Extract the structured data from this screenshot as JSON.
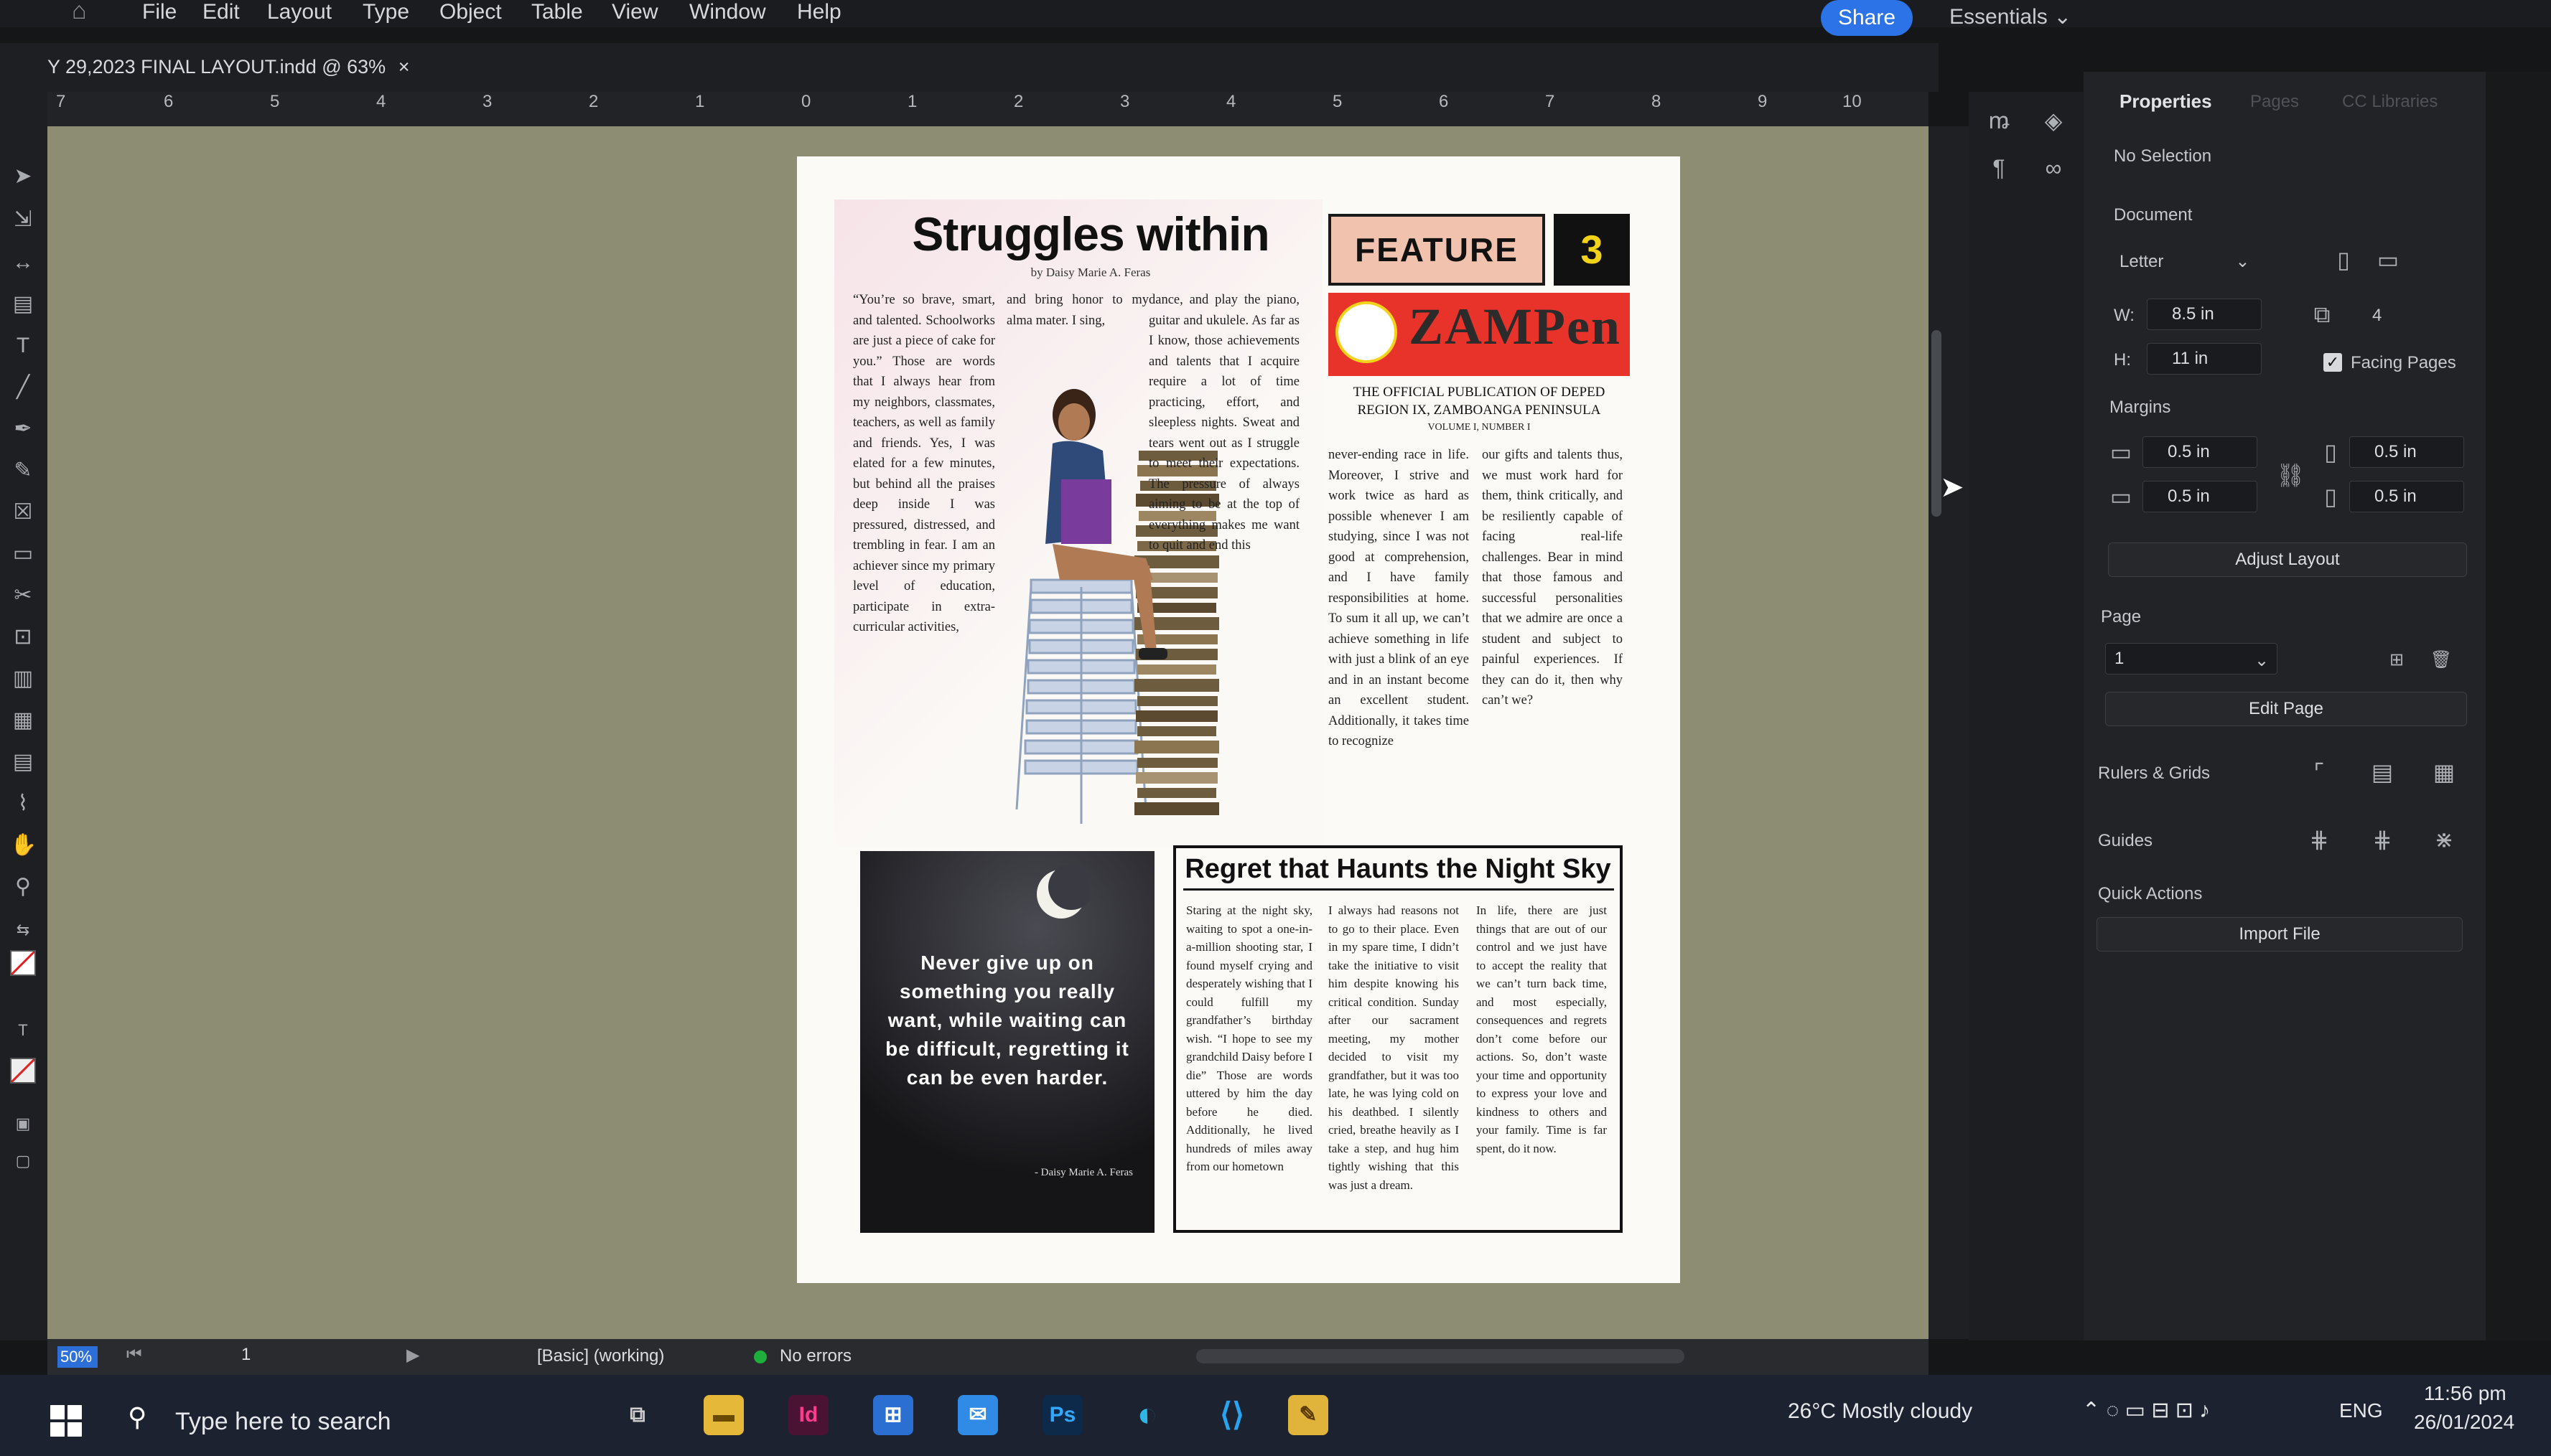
{
  "menubar": {
    "items": [
      "File",
      "Edit",
      "Layout",
      "Type",
      "Object",
      "Table",
      "View",
      "Window",
      "Help"
    ],
    "share": "Share",
    "workspace": "Essentials"
  },
  "tab": {
    "title": "Y 29,2023 FINAL LAYOUT.indd @ 63%",
    "close": "×"
  },
  "ruler": {
    "ticks": [
      "7",
      "6",
      "5",
      "4",
      "3",
      "2",
      "1",
      "0",
      "1",
      "2",
      "3",
      "4",
      "5",
      "6",
      "7",
      "8",
      "9",
      "10"
    ]
  },
  "properties": {
    "tabs": [
      "Properties",
      "Pages",
      "CC Libraries"
    ],
    "selection": "No Selection",
    "document_title": "Document",
    "preset": "Letter",
    "width_label": "W:",
    "width": "8.5 in",
    "height_label": "H:",
    "height": "11 in",
    "pages_count": "4",
    "facing_pages": "Facing Pages",
    "margins_title": "Margins",
    "margin_top": "0.5 in",
    "margin_bottom": "0.5 in",
    "margin_left": "0.5 in",
    "margin_right": "0.5 in",
    "adjust_layout": "Adjust Layout",
    "page_title": "Page",
    "page_value": "1",
    "edit_page": "Edit Page",
    "rulers_grids": "Rulers & Grids",
    "guides": "Guides",
    "quick_actions": "Quick Actions",
    "import_file": "Import File"
  },
  "status": {
    "zoom": "50%",
    "page": "1",
    "style": "[Basic] (working)",
    "errors": "No errors"
  },
  "taskbar": {
    "search": "Type here to search",
    "weather": "26°C  Mostly cloudy",
    "lang": "ENG",
    "time": "11:56 pm",
    "date": "26/01/2024"
  },
  "article": {
    "title": "Struggles within",
    "byline": "by Daisy Marie A. Feras",
    "col1": "“You’re so brave, smart, and talented. Schoolworks are just a piece of cake for you.” Those are words that I always hear from my neighbors, classmates, teachers, as well as family and friends. Yes, I was elated for a few minutes, but behind all the praises deep inside I was pressured, distressed, and trembling in fear. I am an achiever since my primary level of education, participate in extra-curricular activities,",
    "col2a": "and bring honor to my alma mater. I sing,",
    "col3": "dance, and play the piano, guitar and ukulele. As far as I know, those achievements and talents that I acquire require a lot of time practicing, effort, and sleepless nights. Sweat and tears went out as I struggle to meet their expectations. The pressure of always aiming to be at the top of everything makes me want to quit and end this",
    "col4": "never-ending race in life. Moreover, I strive and work twice as hard as possible whenever I am studying, since I was not good at comprehension, and I have family responsibilities at home. To sum it all up, we can’t achieve something in life with just a blink of an eye and in an instant become an excellent student. Additionally, it takes time to recognize",
    "col5": "our gifts and talents thus, we must work hard for them, think critically, and be resiliently capable of facing real-life challenges. Bear in mind that those famous and successful personalities that we admire are once a student and subject to painful experiences. If they can do it, then why can’t we?"
  },
  "masthead": {
    "feature": "FEATURE",
    "number": "3",
    "logo": "ZAMPen",
    "publication": "THE OFFICIAL PUBLICATION OF DEPED REGION IX, ZAMBOANGA PENINSULA",
    "volume": "VOLUME I, NUMBER I"
  },
  "quote": {
    "text": "Never give up on something you really want, while waiting can be difficult, regretting it can be even harder.",
    "author": "- Daisy Marie A. Feras"
  },
  "regret": {
    "title": "Regret that Haunts the Night Sky",
    "col1": "Staring at the night sky, waiting to spot a one-in-a-million shooting star, I found myself crying and desperately wishing that I could fulfill my grandfather’s birthday wish. “I hope to see my grandchild Daisy before I die” Those are words uttered by him the day before he died. Additionally, he lived hundreds of miles away from our hometown",
    "col2": "I always had reasons not to go to their place. Even in my spare time, I didn’t take the initiative to visit him despite knowing his critical condition. Sunday after our sacrament meeting, my mother decided to visit my grandfather, but it was too late, he was lying cold on his deathbed. I silently cried, breathe heavily as I take a step, and hug him tightly wishing that this was just a dream.",
    "col3": "In life, there are just things that are out of our control and we just have to accept the reality that we can’t turn back time, and most especially, consequences and regrets don’t come before our actions. So, don’t waste your time and opportunity to express your love and kindness to others and your family. Time is far spent, do it now."
  }
}
